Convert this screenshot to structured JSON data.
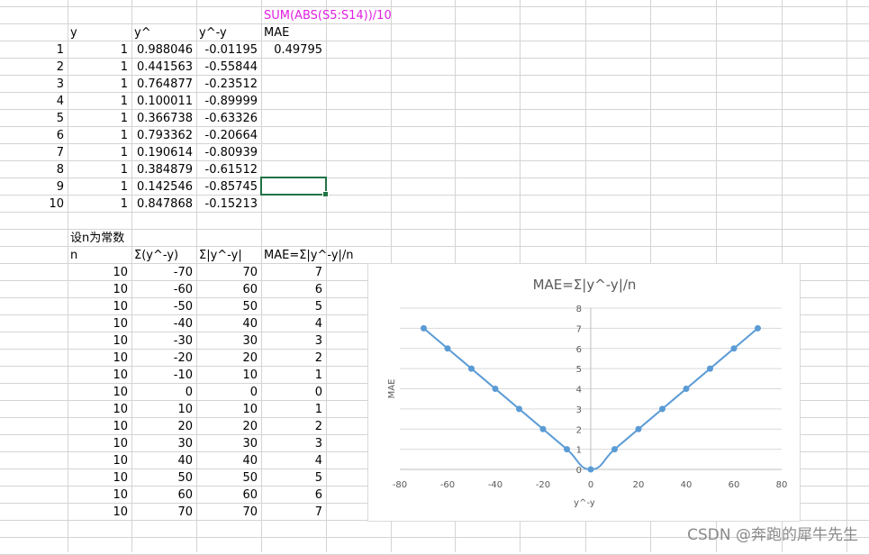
{
  "formula_note": "SUM(ABS(S5:S14))/10",
  "table1": {
    "headers": {
      "y": "y",
      "yhat": "y^",
      "diff": "y^-y",
      "mae": "MAE"
    },
    "mae_value": "0.49795",
    "rows": [
      {
        "idx": "1",
        "y": "1",
        "yhat": "0.988046",
        "diff": "-0.01195"
      },
      {
        "idx": "2",
        "y": "1",
        "yhat": "0.441563",
        "diff": "-0.55844"
      },
      {
        "idx": "3",
        "y": "1",
        "yhat": "0.764877",
        "diff": "-0.23512"
      },
      {
        "idx": "4",
        "y": "1",
        "yhat": "0.100011",
        "diff": "-0.89999"
      },
      {
        "idx": "5",
        "y": "1",
        "yhat": "0.366738",
        "diff": "-0.63326"
      },
      {
        "idx": "6",
        "y": "1",
        "yhat": "0.793362",
        "diff": "-0.20664"
      },
      {
        "idx": "7",
        "y": "1",
        "yhat": "0.190614",
        "diff": "-0.80939"
      },
      {
        "idx": "8",
        "y": "1",
        "yhat": "0.384879",
        "diff": "-0.61512"
      },
      {
        "idx": "9",
        "y": "1",
        "yhat": "0.142546",
        "diff": "-0.85745"
      },
      {
        "idx": "10",
        "y": "1",
        "yhat": "0.847868",
        "diff": "-0.15213"
      }
    ]
  },
  "table2": {
    "caption": "设n为常数",
    "headers": {
      "n": "n",
      "sum": "Σ(y^-y)",
      "abs": "Σ|y^-y|",
      "mae": "MAE=Σ|y^-y|/n"
    },
    "rows": [
      {
        "n": "10",
        "sum": "-70",
        "abs": "70",
        "mae": "7"
      },
      {
        "n": "10",
        "sum": "-60",
        "abs": "60",
        "mae": "6"
      },
      {
        "n": "10",
        "sum": "-50",
        "abs": "50",
        "mae": "5"
      },
      {
        "n": "10",
        "sum": "-40",
        "abs": "40",
        "mae": "4"
      },
      {
        "n": "10",
        "sum": "-30",
        "abs": "30",
        "mae": "3"
      },
      {
        "n": "10",
        "sum": "-20",
        "abs": "20",
        "mae": "2"
      },
      {
        "n": "10",
        "sum": "-10",
        "abs": "10",
        "mae": "1"
      },
      {
        "n": "10",
        "sum": "0",
        "abs": "0",
        "mae": "0"
      },
      {
        "n": "10",
        "sum": "10",
        "abs": "10",
        "mae": "1"
      },
      {
        "n": "10",
        "sum": "20",
        "abs": "20",
        "mae": "2"
      },
      {
        "n": "10",
        "sum": "30",
        "abs": "30",
        "mae": "3"
      },
      {
        "n": "10",
        "sum": "40",
        "abs": "40",
        "mae": "4"
      },
      {
        "n": "10",
        "sum": "50",
        "abs": "50",
        "mae": "5"
      },
      {
        "n": "10",
        "sum": "60",
        "abs": "60",
        "mae": "6"
      },
      {
        "n": "10",
        "sum": "70",
        "abs": "70",
        "mae": "7"
      }
    ]
  },
  "colors": {
    "gridline": "#d4d4d4",
    "series": "#5b9bd5",
    "formula": "#e020e0",
    "selection": "#217346"
  },
  "chart_data": {
    "type": "line",
    "title": "MAE=Σ|y^-y|/n",
    "xlabel": "y^-y",
    "ylabel": "MAE",
    "xlim": [
      -80,
      80
    ],
    "ylim": [
      0,
      8
    ],
    "x_ticks": [
      "-80",
      "-60",
      "-40",
      "-20",
      "0",
      "20",
      "40",
      "60",
      "80"
    ],
    "y_ticks": [
      "0",
      "1",
      "2",
      "3",
      "4",
      "5",
      "6",
      "7",
      "8"
    ],
    "grid": "horizontal",
    "smooth": true,
    "x": [
      -70,
      -60,
      -50,
      -40,
      -30,
      -20,
      -10,
      0,
      10,
      20,
      30,
      40,
      50,
      60,
      70
    ],
    "y": [
      7,
      6,
      5,
      4,
      3,
      2,
      1,
      0,
      1,
      2,
      3,
      4,
      5,
      6,
      7
    ]
  },
  "watermark": "CSDN @奔跑的犀牛先生"
}
